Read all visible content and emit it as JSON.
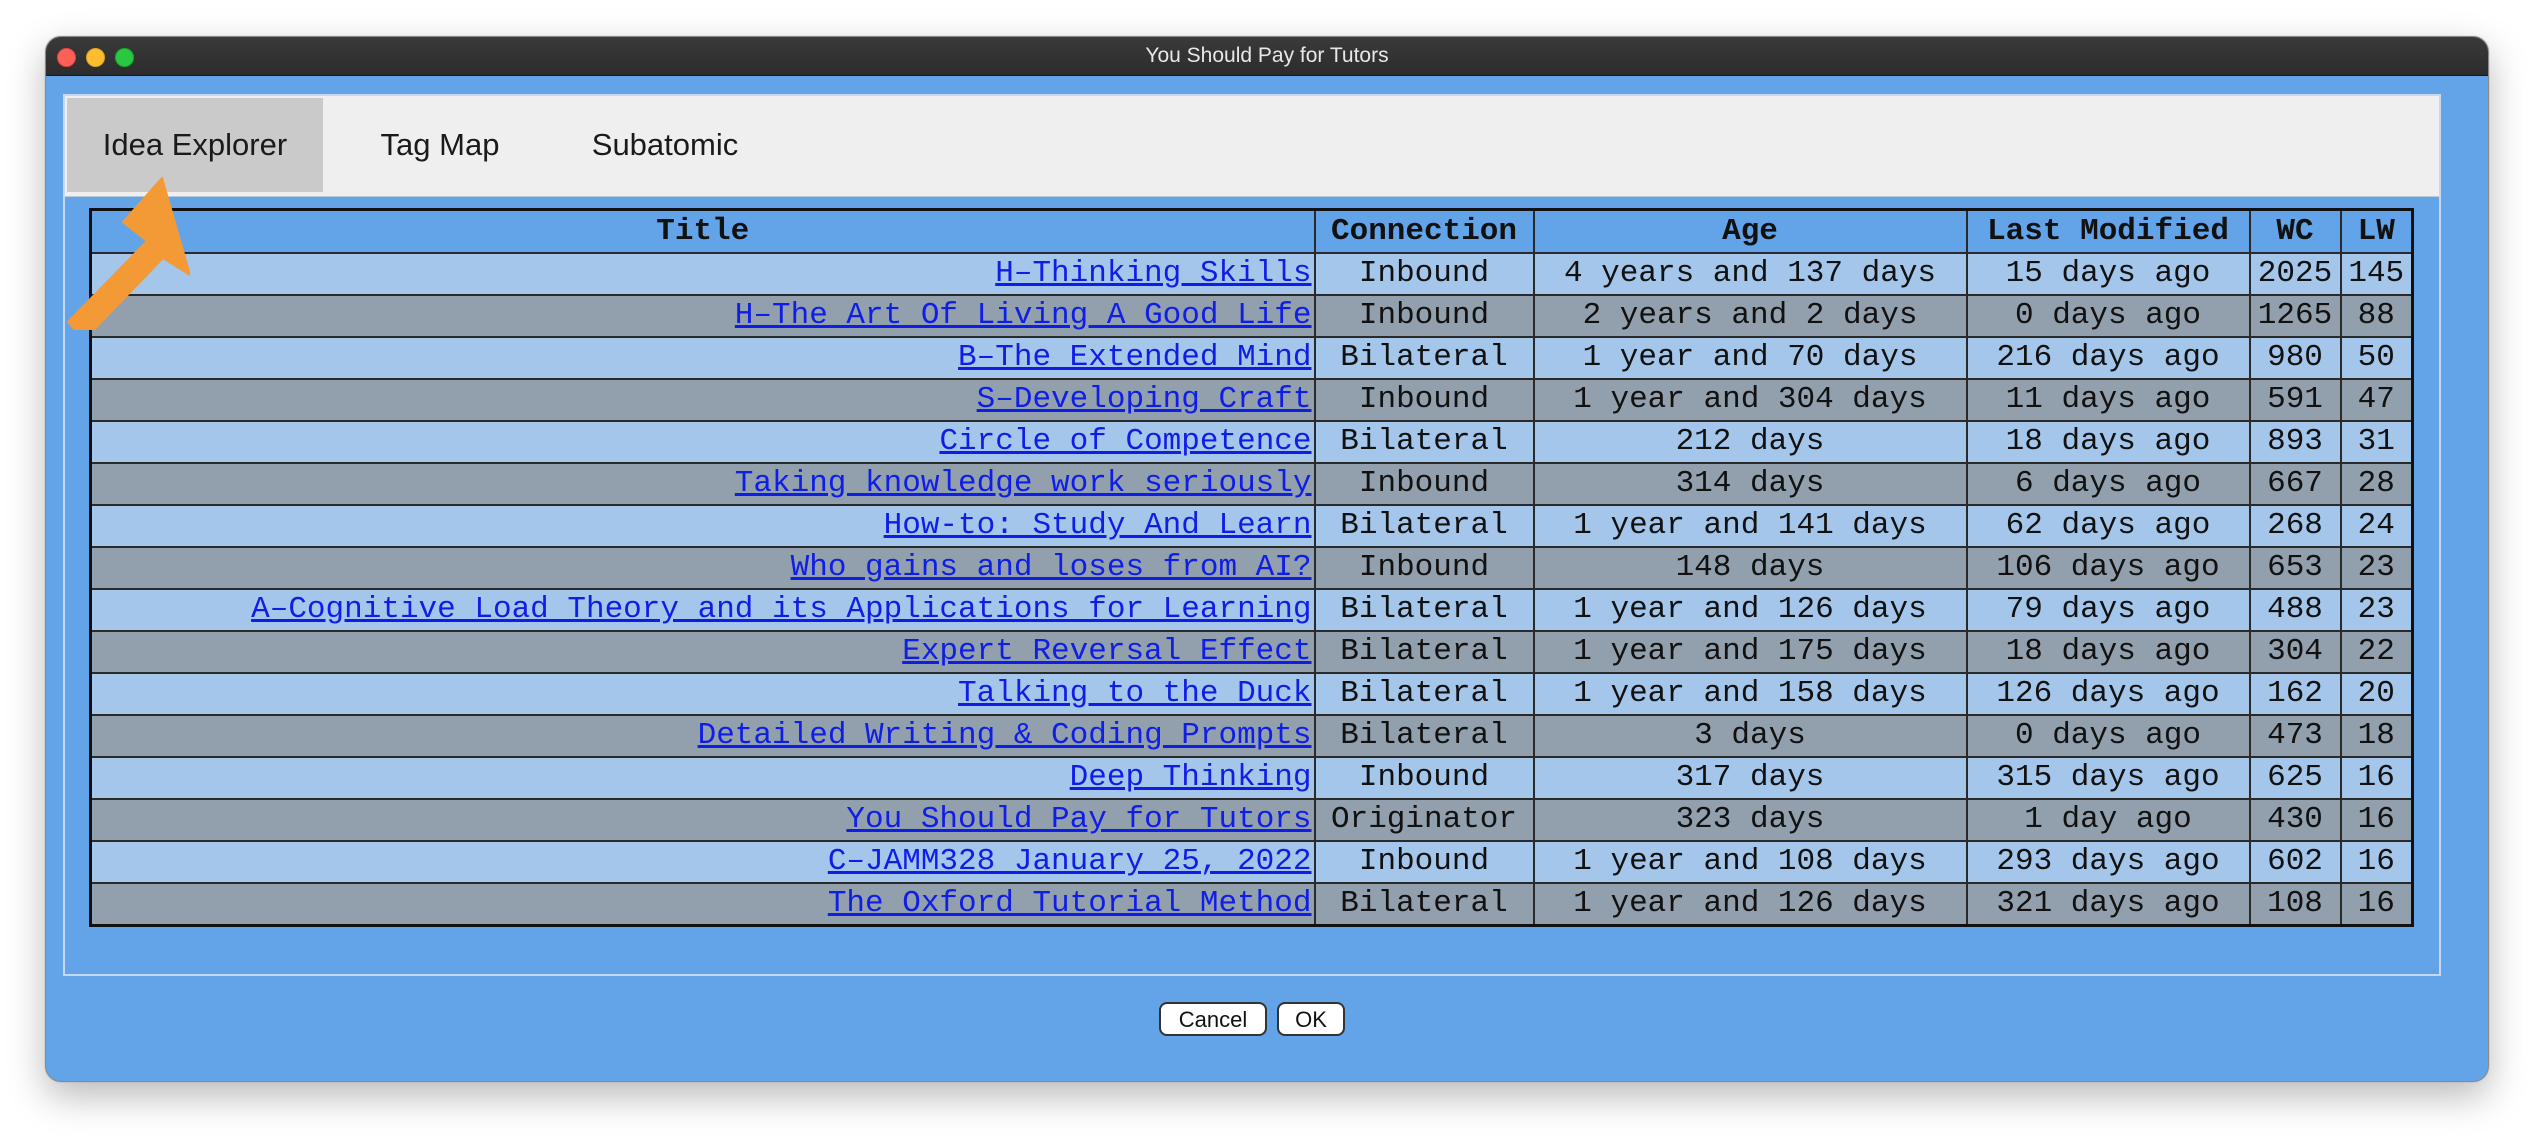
{
  "window": {
    "title": "You Should Pay for Tutors"
  },
  "tabs": [
    {
      "label": "Idea Explorer",
      "active": true
    },
    {
      "label": "Tag Map",
      "active": false
    },
    {
      "label": "Subatomic",
      "active": false
    }
  ],
  "table": {
    "columns": [
      "Title",
      "Connection",
      "Age",
      "Last Modified",
      "WC",
      "LW"
    ],
    "rows": [
      {
        "title": "H–Thinking Skills",
        "connection": "Inbound",
        "age": "4 years and 137 days",
        "last_modified": "15 days ago",
        "wc": "2025",
        "lw": "145"
      },
      {
        "title": "H–The Art Of Living A Good Life",
        "connection": "Inbound",
        "age": "2 years and 2 days",
        "last_modified": "0 days ago",
        "wc": "1265",
        "lw": "88"
      },
      {
        "title": "B–The Extended Mind",
        "connection": "Bilateral",
        "age": "1 year and 70 days",
        "last_modified": "216 days ago",
        "wc": "980",
        "lw": "50"
      },
      {
        "title": "S–Developing Craft",
        "connection": "Inbound",
        "age": "1 year and 304 days",
        "last_modified": "11 days ago",
        "wc": "591",
        "lw": "47"
      },
      {
        "title": "Circle of Competence",
        "connection": "Bilateral",
        "age": "212 days",
        "last_modified": "18 days ago",
        "wc": "893",
        "lw": "31"
      },
      {
        "title": "Taking knowledge work seriously",
        "connection": "Inbound",
        "age": "314 days",
        "last_modified": "6 days ago",
        "wc": "667",
        "lw": "28"
      },
      {
        "title": "How-to: Study And Learn",
        "connection": "Bilateral",
        "age": "1 year and 141 days",
        "last_modified": "62 days ago",
        "wc": "268",
        "lw": "24"
      },
      {
        "title": "Who gains and loses from AI?",
        "connection": "Inbound",
        "age": "148 days",
        "last_modified": "106 days ago",
        "wc": "653",
        "lw": "23"
      },
      {
        "title": "A–Cognitive Load Theory and its Applications for Learning",
        "connection": "Bilateral",
        "age": "1 year and 126 days",
        "last_modified": "79 days ago",
        "wc": "488",
        "lw": "23"
      },
      {
        "title": "Expert Reversal Effect",
        "connection": "Bilateral",
        "age": "1 year and 175 days",
        "last_modified": "18 days ago",
        "wc": "304",
        "lw": "22"
      },
      {
        "title": "Talking to the Duck",
        "connection": "Bilateral",
        "age": "1 year and 158 days",
        "last_modified": "126 days ago",
        "wc": "162",
        "lw": "20"
      },
      {
        "title": "Detailed Writing & Coding Prompts",
        "connection": "Bilateral",
        "age": "3 days",
        "last_modified": "0 days ago",
        "wc": "473",
        "lw": "18"
      },
      {
        "title": "Deep Thinking",
        "connection": "Inbound",
        "age": "317 days",
        "last_modified": "315 days ago",
        "wc": "625",
        "lw": "16"
      },
      {
        "title": "You Should Pay for Tutors",
        "connection": "Originator",
        "age": "323 days",
        "last_modified": "1 day ago",
        "wc": "430",
        "lw": "16"
      },
      {
        "title": "C–JAMM328 January 25, 2022",
        "connection": "Inbound",
        "age": "1 year and 108 days",
        "last_modified": "293 days ago",
        "wc": "602",
        "lw": "16"
      },
      {
        "title": "The Oxford Tutorial Method",
        "connection": "Bilateral",
        "age": "1 year and 126 days",
        "last_modified": "321 days ago",
        "wc": "108",
        "lw": "16"
      }
    ]
  },
  "buttons": {
    "cancel_label": "Cancel",
    "ok_label": "OK"
  },
  "colors": {
    "window_bg": "#62a4e7",
    "row_light": "#a3c6ea",
    "row_dark": "#929fac",
    "link": "#0f1ee6",
    "annotation_arrow": "#f39a36"
  },
  "icons": {
    "annotation": "arrow-pointer-icon"
  }
}
